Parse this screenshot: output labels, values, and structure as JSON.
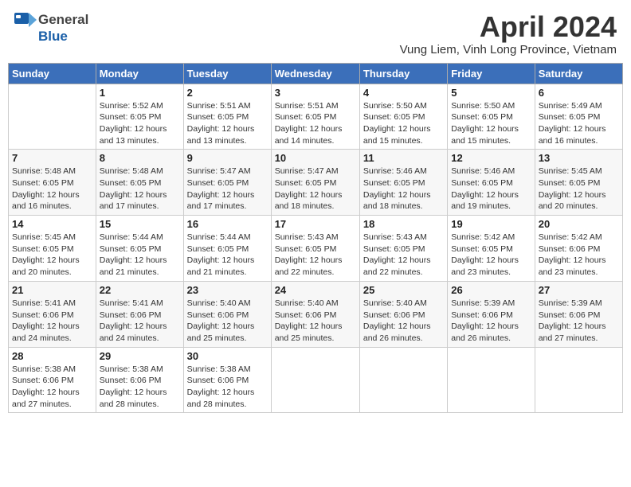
{
  "header": {
    "logo_general": "General",
    "logo_blue": "Blue",
    "month_title": "April 2024",
    "location": "Vung Liem, Vinh Long Province, Vietnam"
  },
  "weekdays": [
    "Sunday",
    "Monday",
    "Tuesday",
    "Wednesday",
    "Thursday",
    "Friday",
    "Saturday"
  ],
  "weeks": [
    [
      {
        "day": "",
        "sunrise": "",
        "sunset": "",
        "daylight": ""
      },
      {
        "day": "1",
        "sunrise": "Sunrise: 5:52 AM",
        "sunset": "Sunset: 6:05 PM",
        "daylight": "Daylight: 12 hours and 13 minutes."
      },
      {
        "day": "2",
        "sunrise": "Sunrise: 5:51 AM",
        "sunset": "Sunset: 6:05 PM",
        "daylight": "Daylight: 12 hours and 13 minutes."
      },
      {
        "day": "3",
        "sunrise": "Sunrise: 5:51 AM",
        "sunset": "Sunset: 6:05 PM",
        "daylight": "Daylight: 12 hours and 14 minutes."
      },
      {
        "day": "4",
        "sunrise": "Sunrise: 5:50 AM",
        "sunset": "Sunset: 6:05 PM",
        "daylight": "Daylight: 12 hours and 15 minutes."
      },
      {
        "day": "5",
        "sunrise": "Sunrise: 5:50 AM",
        "sunset": "Sunset: 6:05 PM",
        "daylight": "Daylight: 12 hours and 15 minutes."
      },
      {
        "day": "6",
        "sunrise": "Sunrise: 5:49 AM",
        "sunset": "Sunset: 6:05 PM",
        "daylight": "Daylight: 12 hours and 16 minutes."
      }
    ],
    [
      {
        "day": "7",
        "sunrise": "Sunrise: 5:48 AM",
        "sunset": "Sunset: 6:05 PM",
        "daylight": "Daylight: 12 hours and 16 minutes."
      },
      {
        "day": "8",
        "sunrise": "Sunrise: 5:48 AM",
        "sunset": "Sunset: 6:05 PM",
        "daylight": "Daylight: 12 hours and 17 minutes."
      },
      {
        "day": "9",
        "sunrise": "Sunrise: 5:47 AM",
        "sunset": "Sunset: 6:05 PM",
        "daylight": "Daylight: 12 hours and 17 minutes."
      },
      {
        "day": "10",
        "sunrise": "Sunrise: 5:47 AM",
        "sunset": "Sunset: 6:05 PM",
        "daylight": "Daylight: 12 hours and 18 minutes."
      },
      {
        "day": "11",
        "sunrise": "Sunrise: 5:46 AM",
        "sunset": "Sunset: 6:05 PM",
        "daylight": "Daylight: 12 hours and 18 minutes."
      },
      {
        "day": "12",
        "sunrise": "Sunrise: 5:46 AM",
        "sunset": "Sunset: 6:05 PM",
        "daylight": "Daylight: 12 hours and 19 minutes."
      },
      {
        "day": "13",
        "sunrise": "Sunrise: 5:45 AM",
        "sunset": "Sunset: 6:05 PM",
        "daylight": "Daylight: 12 hours and 20 minutes."
      }
    ],
    [
      {
        "day": "14",
        "sunrise": "Sunrise: 5:45 AM",
        "sunset": "Sunset: 6:05 PM",
        "daylight": "Daylight: 12 hours and 20 minutes."
      },
      {
        "day": "15",
        "sunrise": "Sunrise: 5:44 AM",
        "sunset": "Sunset: 6:05 PM",
        "daylight": "Daylight: 12 hours and 21 minutes."
      },
      {
        "day": "16",
        "sunrise": "Sunrise: 5:44 AM",
        "sunset": "Sunset: 6:05 PM",
        "daylight": "Daylight: 12 hours and 21 minutes."
      },
      {
        "day": "17",
        "sunrise": "Sunrise: 5:43 AM",
        "sunset": "Sunset: 6:05 PM",
        "daylight": "Daylight: 12 hours and 22 minutes."
      },
      {
        "day": "18",
        "sunrise": "Sunrise: 5:43 AM",
        "sunset": "Sunset: 6:05 PM",
        "daylight": "Daylight: 12 hours and 22 minutes."
      },
      {
        "day": "19",
        "sunrise": "Sunrise: 5:42 AM",
        "sunset": "Sunset: 6:05 PM",
        "daylight": "Daylight: 12 hours and 23 minutes."
      },
      {
        "day": "20",
        "sunrise": "Sunrise: 5:42 AM",
        "sunset": "Sunset: 6:06 PM",
        "daylight": "Daylight: 12 hours and 23 minutes."
      }
    ],
    [
      {
        "day": "21",
        "sunrise": "Sunrise: 5:41 AM",
        "sunset": "Sunset: 6:06 PM",
        "daylight": "Daylight: 12 hours and 24 minutes."
      },
      {
        "day": "22",
        "sunrise": "Sunrise: 5:41 AM",
        "sunset": "Sunset: 6:06 PM",
        "daylight": "Daylight: 12 hours and 24 minutes."
      },
      {
        "day": "23",
        "sunrise": "Sunrise: 5:40 AM",
        "sunset": "Sunset: 6:06 PM",
        "daylight": "Daylight: 12 hours and 25 minutes."
      },
      {
        "day": "24",
        "sunrise": "Sunrise: 5:40 AM",
        "sunset": "Sunset: 6:06 PM",
        "daylight": "Daylight: 12 hours and 25 minutes."
      },
      {
        "day": "25",
        "sunrise": "Sunrise: 5:40 AM",
        "sunset": "Sunset: 6:06 PM",
        "daylight": "Daylight: 12 hours and 26 minutes."
      },
      {
        "day": "26",
        "sunrise": "Sunrise: 5:39 AM",
        "sunset": "Sunset: 6:06 PM",
        "daylight": "Daylight: 12 hours and 26 minutes."
      },
      {
        "day": "27",
        "sunrise": "Sunrise: 5:39 AM",
        "sunset": "Sunset: 6:06 PM",
        "daylight": "Daylight: 12 hours and 27 minutes."
      }
    ],
    [
      {
        "day": "28",
        "sunrise": "Sunrise: 5:38 AM",
        "sunset": "Sunset: 6:06 PM",
        "daylight": "Daylight: 12 hours and 27 minutes."
      },
      {
        "day": "29",
        "sunrise": "Sunrise: 5:38 AM",
        "sunset": "Sunset: 6:06 PM",
        "daylight": "Daylight: 12 hours and 28 minutes."
      },
      {
        "day": "30",
        "sunrise": "Sunrise: 5:38 AM",
        "sunset": "Sunset: 6:06 PM",
        "daylight": "Daylight: 12 hours and 28 minutes."
      },
      {
        "day": "",
        "sunrise": "",
        "sunset": "",
        "daylight": ""
      },
      {
        "day": "",
        "sunrise": "",
        "sunset": "",
        "daylight": ""
      },
      {
        "day": "",
        "sunrise": "",
        "sunset": "",
        "daylight": ""
      },
      {
        "day": "",
        "sunrise": "",
        "sunset": "",
        "daylight": ""
      }
    ]
  ]
}
